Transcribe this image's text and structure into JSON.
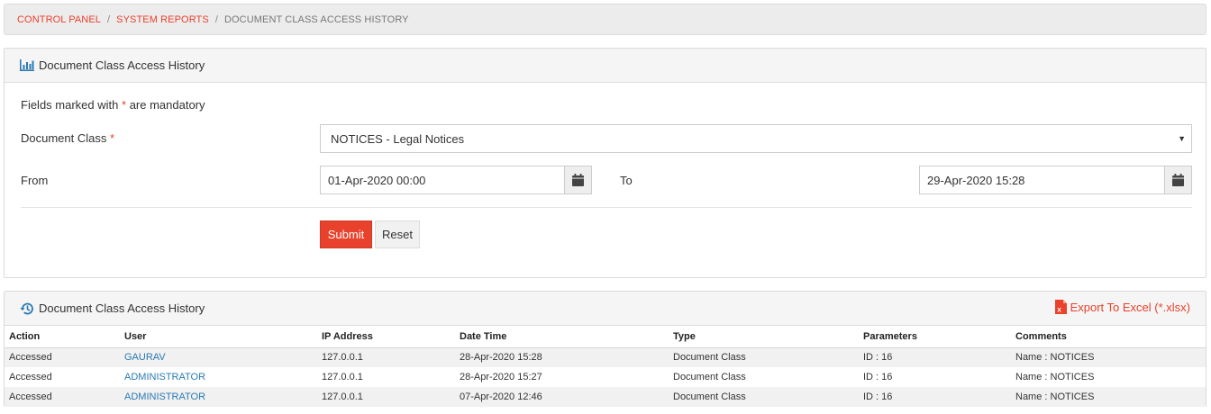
{
  "breadcrumb": {
    "items": [
      "CONTROL PANEL",
      "SYSTEM REPORTS"
    ],
    "separator": "/",
    "current": "DOCUMENT CLASS ACCESS HISTORY"
  },
  "form_panel": {
    "title": "Document Class Access History",
    "icon": "bar-chart-icon",
    "mandatory_prefix": "Fields marked with",
    "mandatory_star": "*",
    "mandatory_suffix": "are mandatory",
    "doc_class_label": "Document Class",
    "doc_class_star": "*",
    "doc_class_value": "NOTICES - Legal Notices",
    "from_label": "From",
    "from_value": "01-Apr-2020 00:00",
    "to_label": "To",
    "to_value": "29-Apr-2020 15:28",
    "submit_label": "Submit",
    "reset_label": "Reset"
  },
  "results_panel": {
    "title": "Document Class Access History",
    "icon": "history-icon",
    "export_label": "Export To Excel (*.xlsx)",
    "export_icon": "excel-file-icon",
    "columns": [
      "Action",
      "User",
      "IP Address",
      "Date Time",
      "Type",
      "Parameters",
      "Comments"
    ],
    "rows": [
      [
        "Accessed",
        "GAURAV",
        "127.0.0.1",
        "28-Apr-2020 15:28",
        "Document Class",
        "ID : 16",
        "Name : NOTICES"
      ],
      [
        "Accessed",
        "ADMINISTRATOR",
        "127.0.0.1",
        "28-Apr-2020 15:27",
        "Document Class",
        "ID : 16",
        "Name : NOTICES"
      ],
      [
        "Accessed",
        "ADMINISTRATOR",
        "127.0.0.1",
        "07-Apr-2020 12:46",
        "Document Class",
        "ID : 16",
        "Name : NOTICES"
      ]
    ]
  },
  "colors": {
    "accent": "#e8412c",
    "link": "#2a7ab5",
    "icon_blue": "#2a7ab5"
  }
}
